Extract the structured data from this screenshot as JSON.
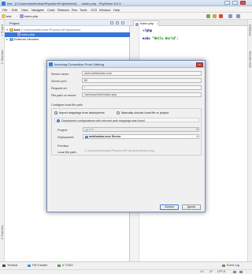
{
  "window": {
    "title": "test - [C:\\Users\\webfoobar\\PhpstormProjects\\test] - ...\\index.php - PhpStorm 8.0.3",
    "accent": "#3a7bd5"
  },
  "menu": [
    "File",
    "Edit",
    "View",
    "Navigate",
    "Code",
    "Refactor",
    "Run",
    "Tools",
    "VCS",
    "Window",
    "Help"
  ],
  "breadcrumb": {
    "project": "test",
    "file": "index.php"
  },
  "project_panel": {
    "title": "Project",
    "left_tool_tabs": [
      "1: Project",
      "2: Structure",
      "2: Favorites"
    ],
    "tree": {
      "root_name": "test",
      "root_path": "C:\\Users\\webfoobar\\PhpstormProjects\\test",
      "child_file": "index.php",
      "external": "External Libraries"
    }
  },
  "right_tool_tabs": [
    "Database",
    "Remote Host"
  ],
  "editor": {
    "tab_label": "index.php",
    "code": {
      "line1": "<?php",
      "line2_kw": "echo",
      "line2_str": "\"Hello World\"",
      "line2_end": ";"
    }
  },
  "dialog": {
    "title": "Incoming Connection From Xdebug",
    "server_name_label": "Server name:",
    "server_name_value": "www.webfoobar.com",
    "server_port_label": "Server port:",
    "server_port_value": "80",
    "request_uri_label": "Request uri:",
    "request_uri_value": "/",
    "file_path_label": "File path on server:",
    "file_path_value": "/var/www/html/index.php",
    "configure_label": "Configure local file path",
    "radio_import": "Import mappings from deployment",
    "radio_manual": "Manually choose local file or project",
    "info_text": "Deployment configurations with relevant path mappings was found.",
    "project_label": "Project:",
    "project_value": "test",
    "deployment_label": "Deployment:",
    "deployment_value": "webfoobar.com Server",
    "preview_label": "Preview:",
    "local_path_label": "Local file path:",
    "local_path_value": "C:\\Users\\webfoobar\\PhpstormProjects\\test\\index.php",
    "accept_label": "Accept",
    "ignore_label": "Ignore"
  },
  "statusbar": {
    "terminal": "Terminal",
    "file_transfer": "File Transfer",
    "todo": "6: TODO",
    "event_log": "Event Log",
    "position": "1:1",
    "line_sep": "LF",
    "encoding": "UTF-8"
  }
}
